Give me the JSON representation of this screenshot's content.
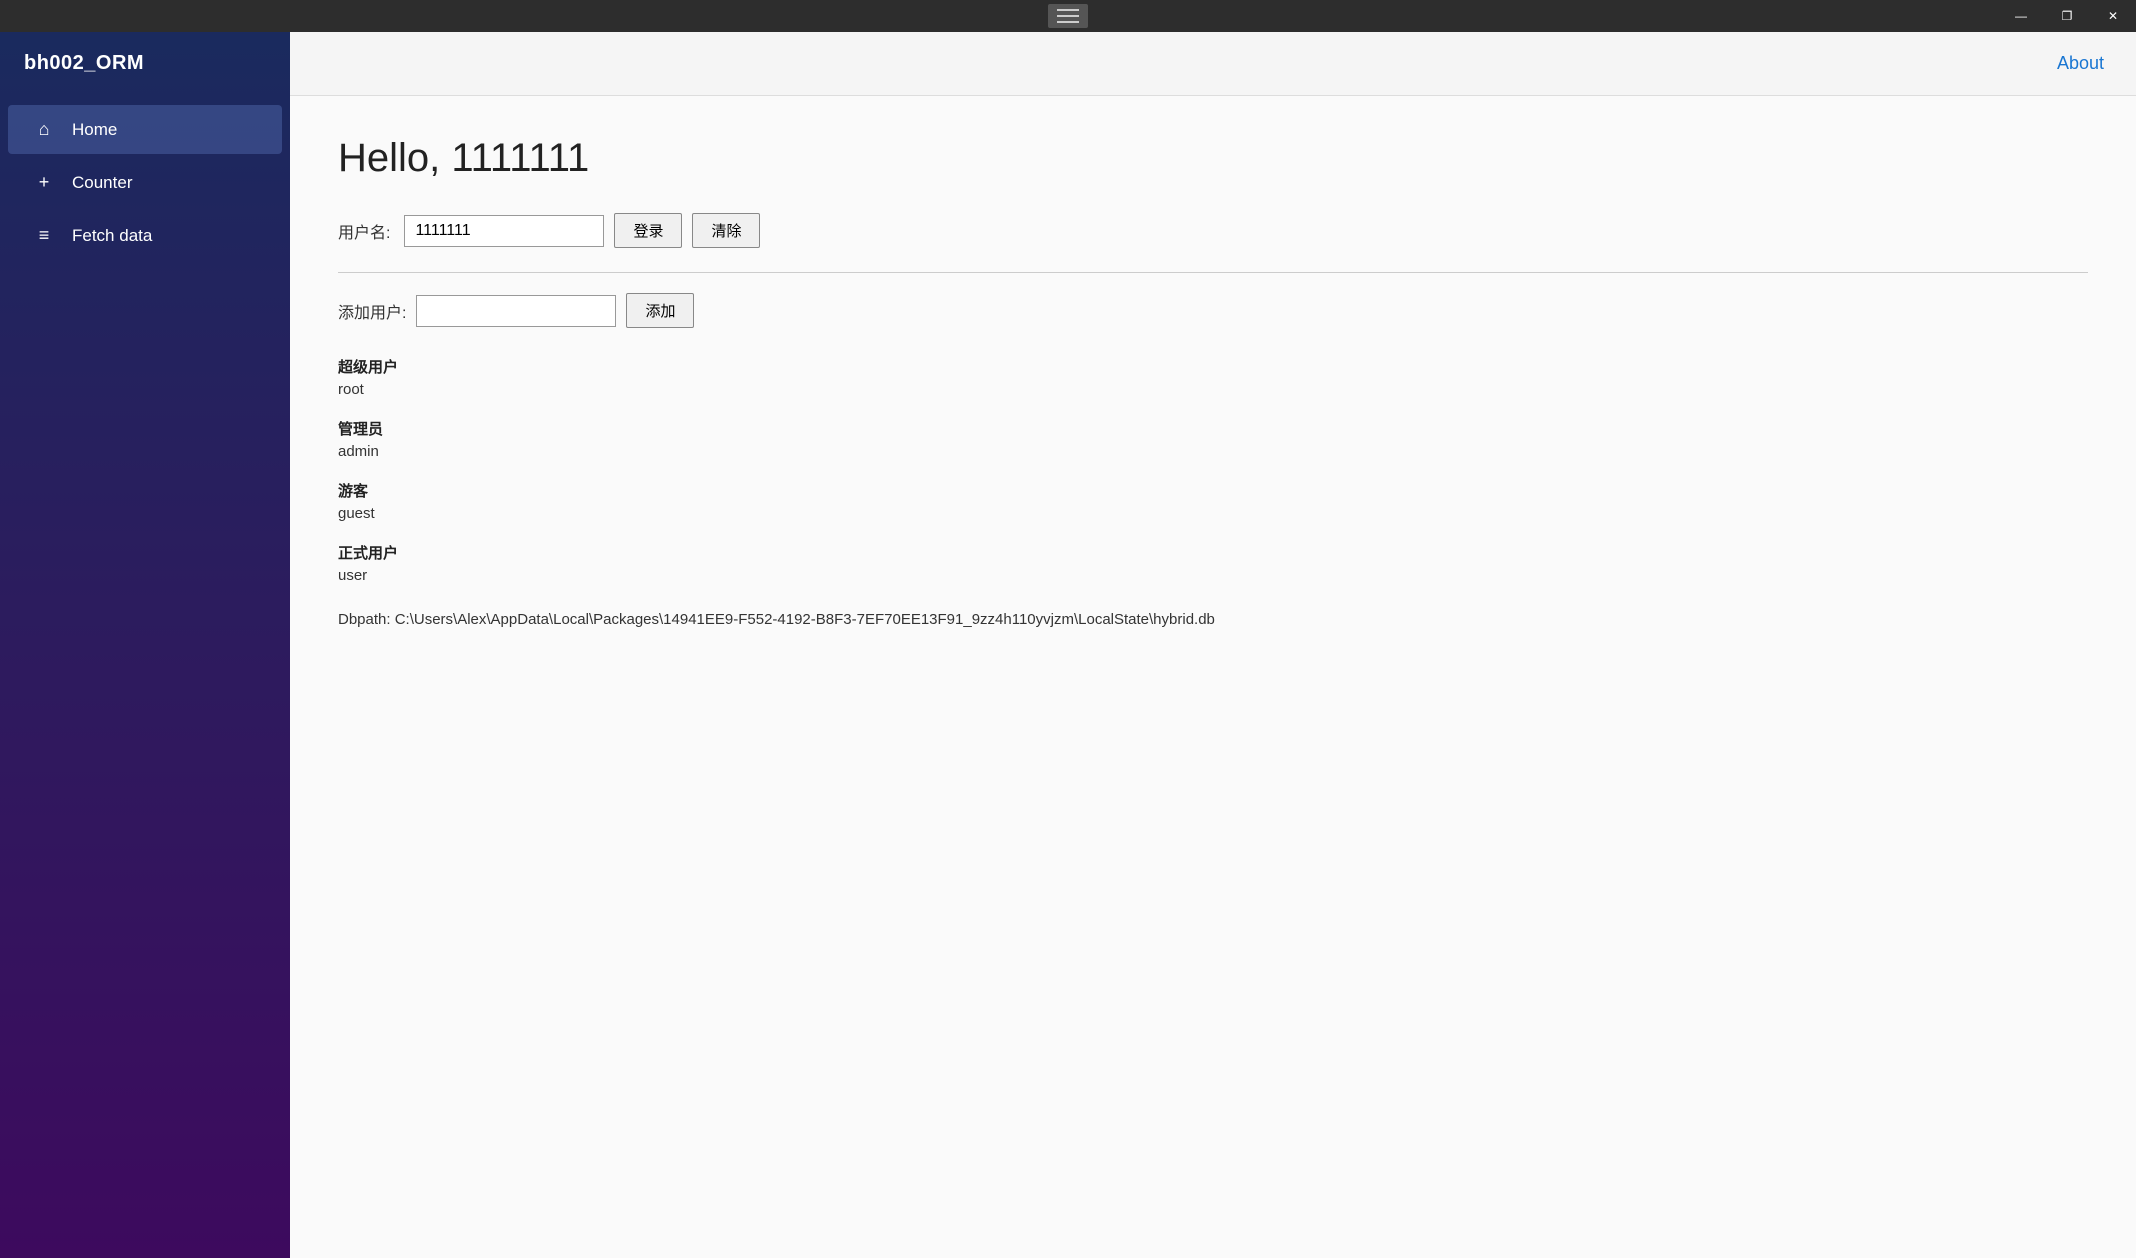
{
  "titleBar": {
    "hamburgerLines": 3,
    "minimizeLabel": "—",
    "restoreLabel": "❐",
    "closeLabel": "✕"
  },
  "sidebar": {
    "brand": "bh002_ORM",
    "items": [
      {
        "id": "home",
        "label": "Home",
        "icon": "⌂",
        "active": true
      },
      {
        "id": "counter",
        "label": "Counter",
        "icon": "+",
        "active": false
      },
      {
        "id": "fetch-data",
        "label": "Fetch data",
        "icon": "≡",
        "active": false
      }
    ]
  },
  "topBar": {
    "aboutLabel": "About"
  },
  "content": {
    "pageTitle": "Hello, 1111111",
    "loginLabel": "用户名:",
    "loginValue": "1111111",
    "loginPlaceholder": "",
    "loginButton": "登录",
    "clearButton": "清除",
    "addUserLabel": "添加用户:",
    "addUserPlaceholder": "",
    "addButton": "添加",
    "userGroups": [
      {
        "title": "超级用户",
        "name": "root"
      },
      {
        "title": "管理员",
        "name": "admin"
      },
      {
        "title": "游客",
        "name": "guest"
      },
      {
        "title": "正式用户",
        "name": "user"
      }
    ],
    "dbpathLabel": "Dbpath: C:\\Users\\Alex\\AppData\\Local\\Packages\\14941EE9-F552-4192-B8F3-7EF70EE13F91_9zz4h110yvjzm\\LocalState\\hybrid.db"
  }
}
